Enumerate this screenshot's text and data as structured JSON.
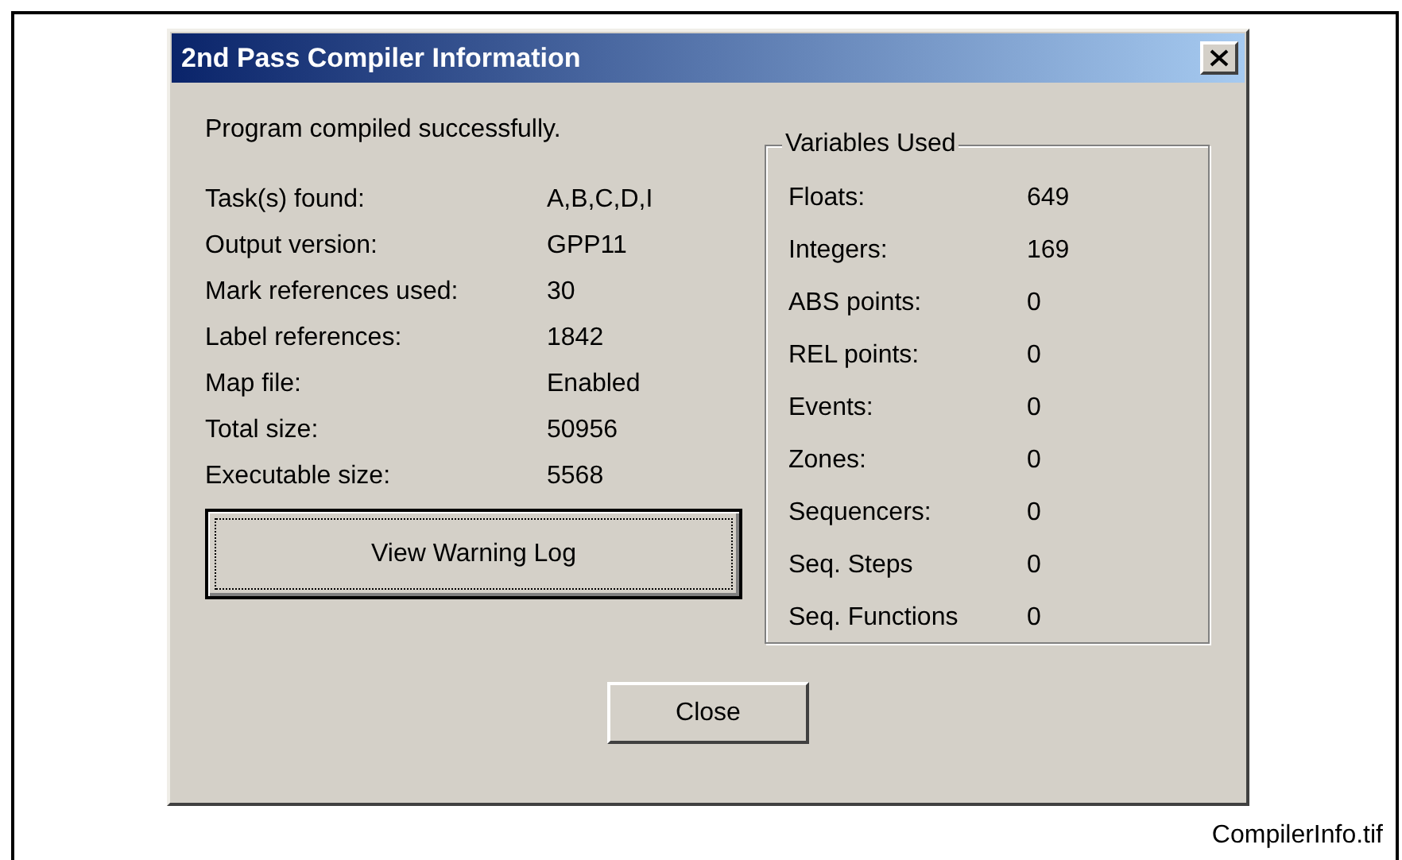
{
  "window": {
    "title": "2nd Pass Compiler Information"
  },
  "message": "Program compiled successfully.",
  "info": [
    {
      "label": "Task(s) found:",
      "value": "A,B,C,D,I"
    },
    {
      "label": "Output version:",
      "value": "GPP11"
    },
    {
      "label": "Mark references used:",
      "value": "30"
    },
    {
      "label": "Label references:",
      "value": "1842"
    },
    {
      "label": "Map file:",
      "value": "Enabled"
    },
    {
      "label": "Total size:",
      "value": "50956"
    },
    {
      "label": "Executable size:",
      "value": "5568"
    }
  ],
  "warning_button": "View Warning Log",
  "variables": {
    "title": "Variables Used",
    "rows": [
      {
        "label": "Floats:",
        "value": "649"
      },
      {
        "label": "Integers:",
        "value": "169"
      },
      {
        "label": "ABS points:",
        "value": "0"
      },
      {
        "label": "REL points:",
        "value": "0"
      },
      {
        "label": "Events:",
        "value": "0"
      },
      {
        "label": "Zones:",
        "value": "0"
      },
      {
        "label": "Sequencers:",
        "value": "0"
      },
      {
        "label": "Seq. Steps",
        "value": "0"
      },
      {
        "label": "Seq. Functions",
        "value": "0"
      }
    ]
  },
  "close_button": "Close",
  "caption": "CompilerInfo.tif"
}
